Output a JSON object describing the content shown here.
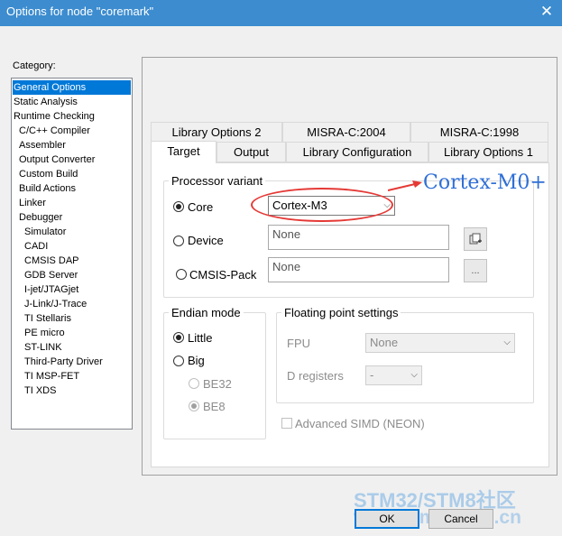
{
  "window": {
    "title": "Options for node \"coremark\"",
    "close_glyph": "✕"
  },
  "category": {
    "label": "Category:",
    "selected_index": 0,
    "items": [
      {
        "label": "General Options",
        "indent": 0
      },
      {
        "label": "Static Analysis",
        "indent": 0
      },
      {
        "label": "Runtime Checking",
        "indent": 0
      },
      {
        "label": "C/C++ Compiler",
        "indent": 1
      },
      {
        "label": "Assembler",
        "indent": 1
      },
      {
        "label": "Output Converter",
        "indent": 1
      },
      {
        "label": "Custom Build",
        "indent": 1
      },
      {
        "label": "Build Actions",
        "indent": 1
      },
      {
        "label": "Linker",
        "indent": 1
      },
      {
        "label": "Debugger",
        "indent": 1
      },
      {
        "label": "Simulator",
        "indent": 2
      },
      {
        "label": "CADI",
        "indent": 2
      },
      {
        "label": "CMSIS DAP",
        "indent": 2
      },
      {
        "label": "GDB Server",
        "indent": 2
      },
      {
        "label": "I-jet/JTAGjet",
        "indent": 2
      },
      {
        "label": "J-Link/J-Trace",
        "indent": 2
      },
      {
        "label": "TI Stellaris",
        "indent": 2
      },
      {
        "label": "PE micro",
        "indent": 2
      },
      {
        "label": "ST-LINK",
        "indent": 2
      },
      {
        "label": "Third-Party Driver",
        "indent": 2
      },
      {
        "label": "TI MSP-FET",
        "indent": 2
      },
      {
        "label": "TI XDS",
        "indent": 2
      }
    ]
  },
  "tabs": {
    "row1": [
      "Library Options 2",
      "MISRA-C:2004",
      "MISRA-C:1998"
    ],
    "row2": [
      "Target",
      "Output",
      "Library Configuration",
      "Library Options 1"
    ],
    "active": "Target"
  },
  "processor": {
    "title": "Processor variant",
    "core_label": "Core",
    "core_value": "Cortex-M3",
    "device_label": "Device",
    "device_value": "None",
    "cmsis_label": "CMSIS-Pack",
    "cmsis_value": "None",
    "cmsis_button": "...",
    "selected": "core"
  },
  "endian": {
    "title": "Endian mode",
    "little": "Little",
    "big": "Big",
    "be32": "BE32",
    "be8": "BE8",
    "selected": "little"
  },
  "floating": {
    "title": "Floating point settings",
    "fpu_label": "FPU",
    "fpu_value": "None",
    "dreg_label": "D registers",
    "dreg_value": "-"
  },
  "simd": {
    "label": "Advanced SIMD (NEON)",
    "checked": false
  },
  "annotation": {
    "text": "Cortex-M0+",
    "text_color": "#2f6fd6",
    "mark_color": "#e53935"
  },
  "watermark": {
    "line1": "STM32/STM8社区",
    "line2": "www.stmcu.org.cn"
  },
  "buttons": {
    "ok": "OK",
    "cancel": "Cancel"
  },
  "colors": {
    "titlebar": "#3c8ccf",
    "selection": "#0078d7"
  }
}
